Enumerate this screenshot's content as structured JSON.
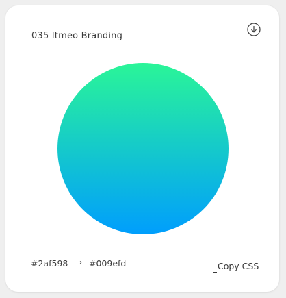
{
  "card": {
    "title": "035 Itmeo Branding",
    "download_icon": "download-circle-icon",
    "gradient": {
      "from": "#2af598",
      "to": "#009efd"
    },
    "colors": {
      "from_label": "#2af598",
      "arrow": "›",
      "to_label": "#009efd"
    },
    "copy_label": "Copy CSS"
  }
}
